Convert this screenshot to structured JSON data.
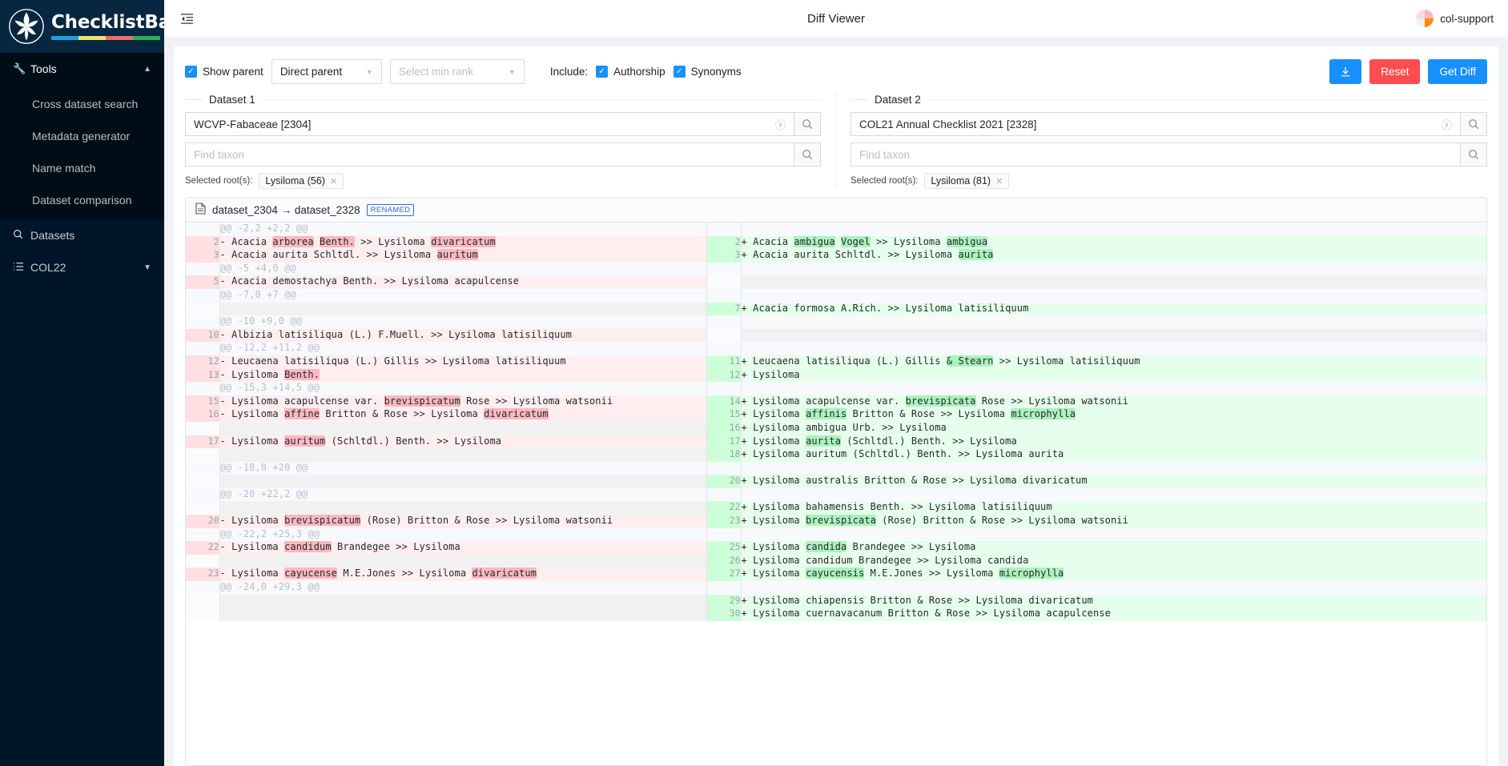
{
  "brand": {
    "name": "ChecklistBank",
    "bar_colors": [
      "#1aa3d8",
      "#efe070",
      "#ef6b6b",
      "#2fae5a"
    ]
  },
  "sidebar": {
    "tools_group": {
      "label": "Tools",
      "icon": "tools-icon",
      "arrow": "▲"
    },
    "tools_items": [
      {
        "label": "Cross dataset search"
      },
      {
        "label": "Metadata generator"
      },
      {
        "label": "Name match"
      },
      {
        "label": "Dataset comparison"
      }
    ],
    "items": [
      {
        "label": "Datasets",
        "icon": "search-icon",
        "arrow": ""
      },
      {
        "label": "COL22",
        "icon": "list-icon",
        "arrow": "▼"
      }
    ]
  },
  "topbar": {
    "collapse_icon": "collapse-menu-icon",
    "title": "Diff Viewer",
    "user": "col-support"
  },
  "toolbar": {
    "show_parent_label": "Show parent",
    "show_parent_checked": true,
    "parent_select_value": "Direct parent",
    "rank_select_placeholder": "Select min rank",
    "include_label": "Include:",
    "authorship_label": "Authorship",
    "authorship_checked": true,
    "synonyms_label": "Synonyms",
    "synonyms_checked": true,
    "download_label": "⤓",
    "reset_label": "Reset",
    "get_diff_label": "Get Diff",
    "accent_primary": "#1890ff",
    "accent_danger": "#ff4d4f"
  },
  "dataset1": {
    "legend": "Dataset 1",
    "value": "WCVP-Fabaceae  [2304]",
    "find_placeholder": "Find taxon",
    "roots_label": "Selected root(s):",
    "root_tag": "Lysiloma (56)"
  },
  "dataset2": {
    "legend": "Dataset 2",
    "value": "COL21 Annual Checklist 2021 [2328]",
    "find_placeholder": "Find taxon",
    "roots_label": "Selected root(s):",
    "root_tag": "Lysiloma (81)"
  },
  "diff": {
    "file_icon": "file-icon",
    "title": "dataset_2304 → dataset_2328",
    "badge": "RENAMED",
    "rows": [
      {
        "type": "hunk",
        "left": {
          "num": "",
          "text": "@@ -2,2 +2,2 @@"
        },
        "right": {
          "num": "",
          "text": ""
        }
      },
      {
        "type": "change",
        "left": {
          "num": "2",
          "kind": "del",
          "parts": [
            {
              "t": "- Acacia "
            },
            {
              "t": "arborea",
              "h": true
            },
            {
              "t": " "
            },
            {
              "t": "Benth.",
              "h": true
            },
            {
              "t": " >> Lysiloma "
            },
            {
              "t": "divaricatum",
              "h": true
            }
          ]
        },
        "right": {
          "num": "2",
          "kind": "ins",
          "parts": [
            {
              "t": "+ Acacia "
            },
            {
              "t": "ambigua",
              "h": true
            },
            {
              "t": " "
            },
            {
              "t": "Vogel",
              "h": true
            },
            {
              "t": " >> Lysiloma "
            },
            {
              "t": "ambigua",
              "h": true
            }
          ]
        }
      },
      {
        "type": "change",
        "left": {
          "num": "3",
          "kind": "del",
          "parts": [
            {
              "t": "- Acacia aurita Schltdl. >> Lysiloma "
            },
            {
              "t": "auritum",
              "h": true
            }
          ]
        },
        "right": {
          "num": "3",
          "kind": "ins",
          "parts": [
            {
              "t": "+ Acacia aurita Schltdl. >> Lysiloma "
            },
            {
              "t": "aurita",
              "h": true
            }
          ]
        }
      },
      {
        "type": "hunk",
        "left": {
          "num": "",
          "text": "@@ -5 +4,0 @@"
        },
        "right": {
          "num": "",
          "text": ""
        }
      },
      {
        "type": "change",
        "left": {
          "num": "5",
          "kind": "del",
          "parts": [
            {
              "t": "- Acacia demostachya Benth. >> Lysiloma acapulcense"
            }
          ]
        },
        "right": {
          "num": "",
          "kind": "empty",
          "parts": []
        }
      },
      {
        "type": "hunk",
        "left": {
          "num": "",
          "text": "@@ -7,0 +7 @@"
        },
        "right": {
          "num": "",
          "text": ""
        }
      },
      {
        "type": "change",
        "left": {
          "num": "",
          "kind": "empty",
          "parts": []
        },
        "right": {
          "num": "7",
          "kind": "ins",
          "parts": [
            {
              "t": "+ Acacia formosa A.Rich. >> Lysiloma latisiliquum"
            }
          ]
        }
      },
      {
        "type": "hunk",
        "left": {
          "num": "",
          "text": "@@ -10 +9,0 @@"
        },
        "right": {
          "num": "",
          "text": ""
        }
      },
      {
        "type": "change",
        "left": {
          "num": "10",
          "kind": "del",
          "parts": [
            {
              "t": "- Albizia latisiliqua (L.) F.Muell. >> Lysiloma latisiliquum"
            }
          ]
        },
        "right": {
          "num": "",
          "kind": "empty",
          "parts": []
        }
      },
      {
        "type": "hunk",
        "left": {
          "num": "",
          "text": "@@ -12,2 +11,2 @@"
        },
        "right": {
          "num": "",
          "text": ""
        }
      },
      {
        "type": "change",
        "left": {
          "num": "12",
          "kind": "del",
          "parts": [
            {
              "t": "- Leucaena latisiliqua (L.) Gillis >> Lysiloma latisiliquum"
            }
          ]
        },
        "right": {
          "num": "11",
          "kind": "ins",
          "parts": [
            {
              "t": "+ Leucaena latisiliqua (L.) Gillis "
            },
            {
              "t": "& Stearn",
              "h": true
            },
            {
              "t": " >> Lysiloma latisiliquum"
            }
          ]
        }
      },
      {
        "type": "change",
        "left": {
          "num": "13",
          "kind": "del",
          "parts": [
            {
              "t": "- Lysiloma "
            },
            {
              "t": "Benth.",
              "h": true
            }
          ]
        },
        "right": {
          "num": "12",
          "kind": "ins",
          "parts": [
            {
              "t": "+ Lysiloma"
            }
          ]
        }
      },
      {
        "type": "hunk",
        "left": {
          "num": "",
          "text": "@@ -15,3 +14,5 @@"
        },
        "right": {
          "num": "",
          "text": ""
        }
      },
      {
        "type": "change",
        "left": {
          "num": "15",
          "kind": "del",
          "parts": [
            {
              "t": "- Lysiloma acapulcense var. "
            },
            {
              "t": "brevispicatum",
              "h": true
            },
            {
              "t": " Rose >> Lysiloma watsonii"
            }
          ]
        },
        "right": {
          "num": "14",
          "kind": "ins",
          "parts": [
            {
              "t": "+ Lysiloma acapulcense var. "
            },
            {
              "t": "brevispicata",
              "h": true
            },
            {
              "t": " Rose >> Lysiloma watsonii"
            }
          ]
        }
      },
      {
        "type": "change",
        "left": {
          "num": "16",
          "kind": "del",
          "parts": [
            {
              "t": "- Lysiloma "
            },
            {
              "t": "affine",
              "h": true
            },
            {
              "t": " Britton & Rose >> Lysiloma "
            },
            {
              "t": "divaricatum",
              "h": true
            }
          ]
        },
        "right": {
          "num": "15",
          "kind": "ins",
          "parts": [
            {
              "t": "+ Lysiloma "
            },
            {
              "t": "affinis",
              "h": true
            },
            {
              "t": " Britton & Rose >> Lysiloma "
            },
            {
              "t": "microphylla",
              "h": true
            }
          ]
        }
      },
      {
        "type": "change",
        "left": {
          "num": "",
          "kind": "empty",
          "parts": []
        },
        "right": {
          "num": "16",
          "kind": "ins",
          "parts": [
            {
              "t": "+ Lysiloma ambigua Urb. >> Lysiloma"
            }
          ]
        }
      },
      {
        "type": "change",
        "left": {
          "num": "17",
          "kind": "del",
          "parts": [
            {
              "t": "- Lysiloma "
            },
            {
              "t": "auritum",
              "h": true
            },
            {
              "t": " (Schltdl.) Benth. >> Lysiloma"
            }
          ]
        },
        "right": {
          "num": "17",
          "kind": "ins",
          "parts": [
            {
              "t": "+ Lysiloma "
            },
            {
              "t": "aurita",
              "h": true
            },
            {
              "t": " (Schltdl.) Benth. >> Lysiloma"
            }
          ]
        }
      },
      {
        "type": "change",
        "left": {
          "num": "",
          "kind": "empty",
          "parts": []
        },
        "right": {
          "num": "18",
          "kind": "ins",
          "parts": [
            {
              "t": "+ Lysiloma auritum (Schltdl.) Benth. >> Lysiloma aurita"
            }
          ]
        }
      },
      {
        "type": "hunk",
        "left": {
          "num": "",
          "text": "@@ -18,0 +20 @@"
        },
        "right": {
          "num": "",
          "text": ""
        }
      },
      {
        "type": "change",
        "left": {
          "num": "",
          "kind": "empty",
          "parts": []
        },
        "right": {
          "num": "20",
          "kind": "ins",
          "parts": [
            {
              "t": "+ Lysiloma australis Britton & Rose >> Lysiloma divaricatum"
            }
          ]
        }
      },
      {
        "type": "hunk",
        "left": {
          "num": "",
          "text": "@@ -20 +22,2 @@"
        },
        "right": {
          "num": "",
          "text": ""
        }
      },
      {
        "type": "change",
        "left": {
          "num": "",
          "kind": "empty",
          "parts": []
        },
        "right": {
          "num": "22",
          "kind": "ins",
          "parts": [
            {
              "t": "+ Lysiloma bahamensis Benth. >> Lysiloma latisiliquum"
            }
          ]
        }
      },
      {
        "type": "change",
        "left": {
          "num": "20",
          "kind": "del",
          "parts": [
            {
              "t": "- Lysiloma "
            },
            {
              "t": "brevispicatum",
              "h": true
            },
            {
              "t": " (Rose) Britton & Rose >> Lysiloma watsonii"
            }
          ]
        },
        "right": {
          "num": "23",
          "kind": "ins",
          "parts": [
            {
              "t": "+ Lysiloma "
            },
            {
              "t": "brevispicata",
              "h": true
            },
            {
              "t": " (Rose) Britton & Rose >> Lysiloma watsonii"
            }
          ]
        }
      },
      {
        "type": "hunk",
        "left": {
          "num": "",
          "text": "@@ -22,2 +25,3 @@"
        },
        "right": {
          "num": "",
          "text": ""
        }
      },
      {
        "type": "change",
        "left": {
          "num": "22",
          "kind": "del",
          "parts": [
            {
              "t": "- Lysiloma "
            },
            {
              "t": "candidum",
              "h": true
            },
            {
              "t": " Brandegee >> Lysiloma"
            }
          ]
        },
        "right": {
          "num": "25",
          "kind": "ins",
          "parts": [
            {
              "t": "+ Lysiloma "
            },
            {
              "t": "candida",
              "h": true
            },
            {
              "t": " Brandegee >> Lysiloma"
            }
          ]
        }
      },
      {
        "type": "change",
        "left": {
          "num": "",
          "kind": "empty",
          "parts": []
        },
        "right": {
          "num": "26",
          "kind": "ins",
          "parts": [
            {
              "t": "+ Lysiloma candidum Brandegee >> Lysiloma candida"
            }
          ]
        }
      },
      {
        "type": "change",
        "left": {
          "num": "23",
          "kind": "del",
          "parts": [
            {
              "t": "- Lysiloma "
            },
            {
              "t": "cayucense",
              "h": true
            },
            {
              "t": " M.E.Jones >> Lysiloma "
            },
            {
              "t": "divaricatum",
              "h": true
            }
          ]
        },
        "right": {
          "num": "27",
          "kind": "ins",
          "parts": [
            {
              "t": "+ Lysiloma "
            },
            {
              "t": "cayucensis",
              "h": true
            },
            {
              "t": " M.E.Jones >> Lysiloma "
            },
            {
              "t": "microphylla",
              "h": true
            }
          ]
        }
      },
      {
        "type": "hunk",
        "left": {
          "num": "",
          "text": "@@ -24,0 +29,3 @@"
        },
        "right": {
          "num": "",
          "text": ""
        }
      },
      {
        "type": "change",
        "left": {
          "num": "",
          "kind": "empty",
          "parts": []
        },
        "right": {
          "num": "29",
          "kind": "ins",
          "parts": [
            {
              "t": "+ Lysiloma chiapensis Britton & Rose >> Lysiloma divaricatum"
            }
          ]
        }
      },
      {
        "type": "change",
        "left": {
          "num": "",
          "kind": "empty",
          "parts": []
        },
        "right": {
          "num": "30",
          "kind": "ins",
          "parts": [
            {
              "t": "+ Lysiloma cuernavacanum Britton & Rose >> Lysiloma acapulcense"
            }
          ]
        }
      }
    ]
  }
}
